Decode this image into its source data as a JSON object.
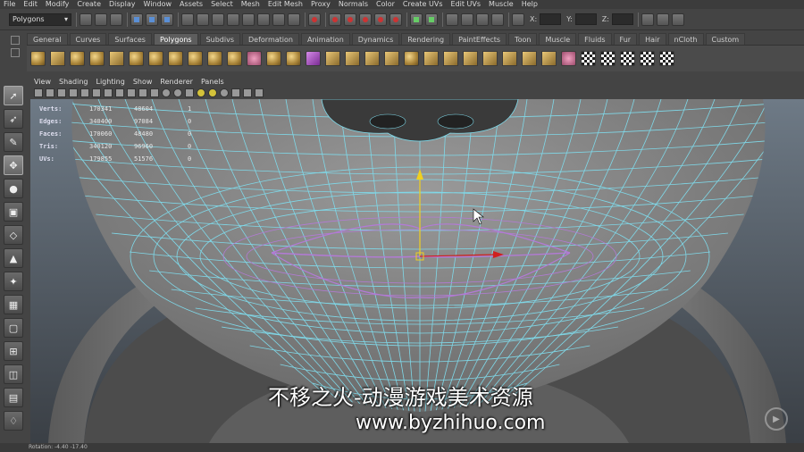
{
  "menubar": [
    "File",
    "Edit",
    "Modify",
    "Create",
    "Display",
    "Window",
    "Assets",
    "Select",
    "Mesh",
    "Edit Mesh",
    "Proxy",
    "Normals",
    "Color",
    "Create UVs",
    "Edit UVs",
    "Muscle",
    "Help"
  ],
  "statusline": {
    "mode": "Polygons",
    "x_label": "X:",
    "y_label": "Y:",
    "z_label": "Z:"
  },
  "shelf_tabs": [
    "General",
    "Curves",
    "Surfaces",
    "Polygons",
    "Subdivs",
    "Deformation",
    "Animation",
    "Dynamics",
    "Rendering",
    "PaintEffects",
    "Toon",
    "Muscle",
    "Fluids",
    "Fur",
    "Hair",
    "nCloth",
    "Custom"
  ],
  "shelf_active_tab": "Polygons",
  "panel_menu": [
    "View",
    "Shading",
    "Lighting",
    "Show",
    "Renderer",
    "Panels"
  ],
  "hud": {
    "rows": [
      {
        "label": "Verts:",
        "v1": "170341",
        "v2": "48604",
        "v3": "1"
      },
      {
        "label": "Edges:",
        "v1": "340400",
        "v2": "97084",
        "v3": "0"
      },
      {
        "label": "Faces:",
        "v1": "170060",
        "v2": "48480",
        "v3": "0"
      },
      {
        "label": "Tris:",
        "v1": "340120",
        "v2": "96960",
        "v3": "0"
      },
      {
        "label": "UVs:",
        "v1": "179855",
        "v2": "51576",
        "v3": "0"
      }
    ]
  },
  "watermark": {
    "line1": "不移之火-动漫游戏美术资源",
    "line2": "www.byzhihuo.com"
  },
  "statusbar": {
    "text": "Rotation: -4.40 -17.40"
  },
  "icons": {
    "play_badge": "play-icon"
  },
  "colors": {
    "wire": "#7fd8e8",
    "wire_selected": "#b37ad6",
    "background_top": "#6e7a86",
    "background_bottom": "#3a3f45",
    "mesh": "#8a8a8a",
    "manip_y": "#f0d020",
    "manip_x": "#d02020"
  }
}
